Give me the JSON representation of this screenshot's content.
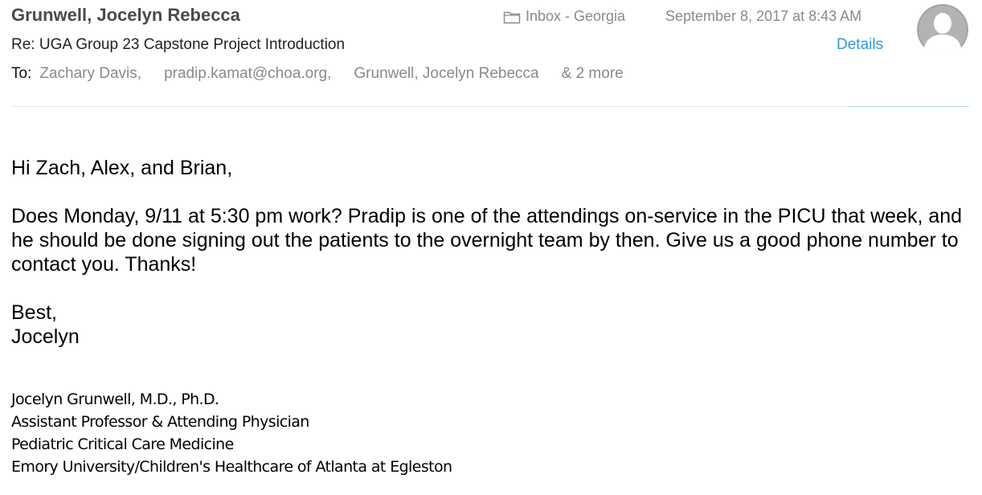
{
  "header": {
    "sender": "Grunwell, Jocelyn Rebecca",
    "mailbox": "Inbox - Georgia",
    "date": "September 8, 2017 at 8:43 AM",
    "subject": "Re: UGA Group 23 Capstone Project Introduction",
    "details_label": "Details",
    "to_label": "To:",
    "recipients": [
      "Zachary Davis,",
      "pradip.kamat@choa.org,",
      "Grunwell, Jocelyn Rebecca"
    ],
    "more_label": "& 2 more",
    "folder_icon": "folder-icon",
    "avatar_icon": "person-silhouette-icon"
  },
  "body": {
    "greeting": "Hi Zach, Alex, and Brian,",
    "paragraph": "Does Monday, 9/11 at 5:30 pm work?  Pradip is one of the attendings on-service in the PICU that week, and he should be done signing out the patients to the overnight team by then.  Give us a good phone number to contact you.  Thanks!",
    "closing": "Best,",
    "name": "Jocelyn"
  },
  "signature": {
    "lines": [
      "Jocelyn Grunwell, M.D., Ph.D.",
      "Assistant Professor & Attending Physician",
      "Pediatric Critical Care Medicine",
      "Emory University/Children's Healthcare of Atlanta at Egleston"
    ]
  },
  "colors": {
    "link": "#2f9bd9",
    "secondary_text": "#8a8a8a",
    "sender_text": "#4a4a4a",
    "avatar_bg": "#b3b3b3"
  }
}
